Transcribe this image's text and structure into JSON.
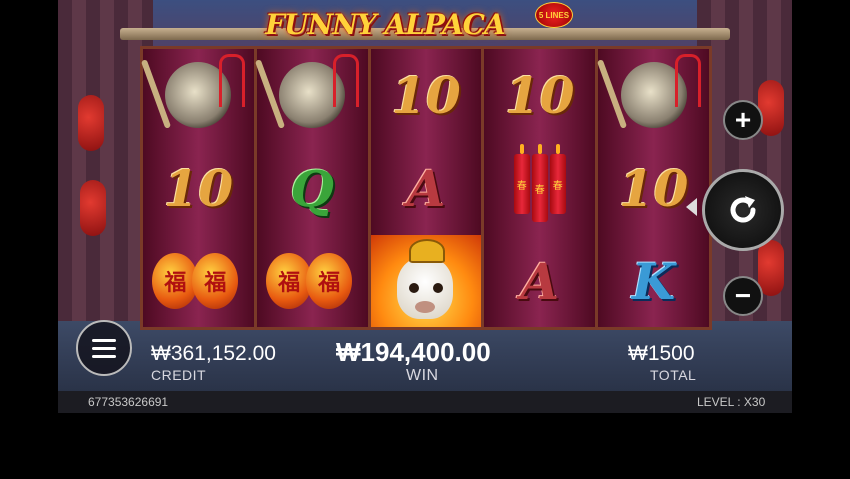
{
  "game": {
    "logo_title": "FUNNY ALPACA",
    "lines_badge": "5 LINES"
  },
  "reels": [
    [
      "gong",
      "10",
      "lanterns"
    ],
    [
      "gong",
      "Q",
      "lanterns"
    ],
    [
      "10",
      "A",
      "alpaca"
    ],
    [
      "10",
      "firecrackers",
      "A"
    ],
    [
      "gong",
      "10",
      "K"
    ]
  ],
  "symbols": {
    "ten": "10",
    "q": "Q",
    "a": "A",
    "k": "K",
    "lantern_char": "福",
    "firecracker_char": "春"
  },
  "controls": {
    "plus_label": "+",
    "minus_label": "−",
    "spin_icon": "refresh-icon",
    "menu_icon": "hamburger-icon"
  },
  "balance": {
    "credit_value": "₩361,152.00",
    "credit_label": "CREDIT",
    "win_value": "₩194,400.00",
    "win_label": "WIN",
    "total_value": "₩1500",
    "total_label": "TOTAL"
  },
  "footer": {
    "session_id": "677353626691",
    "level_text": "LEVEL : X30"
  }
}
